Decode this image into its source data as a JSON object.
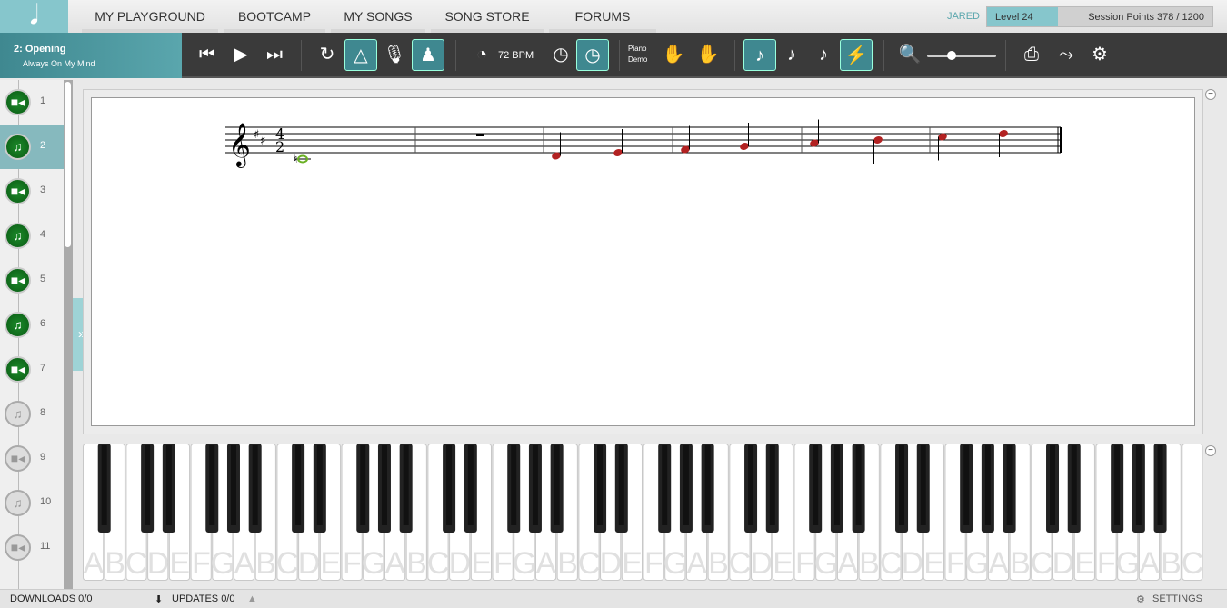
{
  "nav": {
    "logo_icon": "music-note-icon",
    "items": [
      "MY PLAYGROUND",
      "BOOTCAMP",
      "MY SONGS",
      "SONG STORE",
      "FORUMS"
    ]
  },
  "user": {
    "name": "JARED",
    "level": "Level 24",
    "session_points": "Session Points 378 / 1200",
    "points_fraction": 0.315
  },
  "song": {
    "title": "2: Opening",
    "subtitle": "Always On My Mind"
  },
  "toolbar": {
    "tempo": "72 BPM",
    "mode_label_1": "Piano",
    "mode_label_2": "Demo",
    "zoom_level": 0.35
  },
  "lessons": [
    {
      "n": "1",
      "type": "video",
      "done": true
    },
    {
      "n": "2",
      "type": "song",
      "done": true,
      "selected": true
    },
    {
      "n": "3",
      "type": "video",
      "done": true
    },
    {
      "n": "4",
      "type": "song",
      "done": true
    },
    {
      "n": "5",
      "type": "video",
      "done": true
    },
    {
      "n": "6",
      "type": "song",
      "done": true
    },
    {
      "n": "7",
      "type": "video",
      "done": true
    },
    {
      "n": "8",
      "type": "song",
      "done": false
    },
    {
      "n": "9",
      "type": "video",
      "done": false
    },
    {
      "n": "10",
      "type": "song",
      "done": false
    },
    {
      "n": "11",
      "type": "video",
      "done": false
    }
  ],
  "score": {
    "key": "D major",
    "time": "4/2",
    "notes": [
      "C4",
      "D4",
      "E4",
      "F#4",
      "G4",
      "A4",
      "B4",
      "C#5",
      "D5"
    ],
    "colors": {
      "played": "#6ab023",
      "pending": "#b22222"
    }
  },
  "keyboard": {
    "white_key_letters": "ABCDEFG",
    "white_keys": 52
  },
  "bottom": {
    "downloads": "DOWNLOADS 0/0",
    "updates": "UPDATES 0/0",
    "settings": "SETTINGS"
  }
}
